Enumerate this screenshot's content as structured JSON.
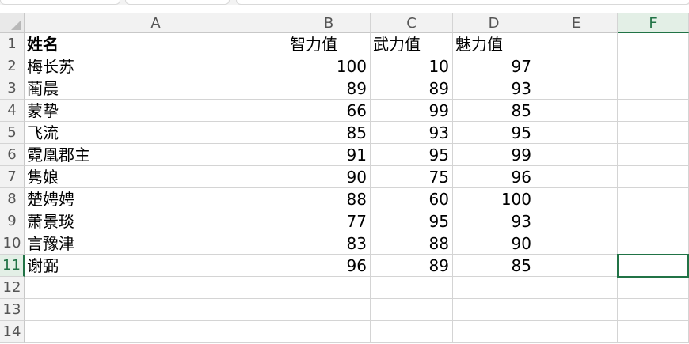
{
  "columns": [
    "A",
    "B",
    "C",
    "D",
    "E",
    "F"
  ],
  "row_numbers": [
    "1",
    "2",
    "3",
    "4",
    "5",
    "6",
    "7",
    "8",
    "9",
    "10",
    "11",
    "12",
    "13",
    "14"
  ],
  "header_row": [
    "姓名",
    "智力值",
    "武力值",
    "魅力值"
  ],
  "rows": [
    [
      "梅长苏",
      "100",
      "10",
      "97"
    ],
    [
      "蔺晨",
      "89",
      "89",
      "93"
    ],
    [
      "蒙挚",
      "66",
      "99",
      "85"
    ],
    [
      "飞流",
      "85",
      "93",
      "95"
    ],
    [
      "霓凰郡主",
      "91",
      "95",
      "99"
    ],
    [
      "隽娘",
      "90",
      "75",
      "96"
    ],
    [
      "楚娉娉",
      "88",
      "60",
      "100"
    ],
    [
      "萧景琰",
      "77",
      "95",
      "93"
    ],
    [
      "言豫津",
      "83",
      "88",
      "90"
    ],
    [
      "谢弼",
      "96",
      "89",
      "85"
    ]
  ],
  "active_cell": "F11",
  "accent_color": "#217346"
}
